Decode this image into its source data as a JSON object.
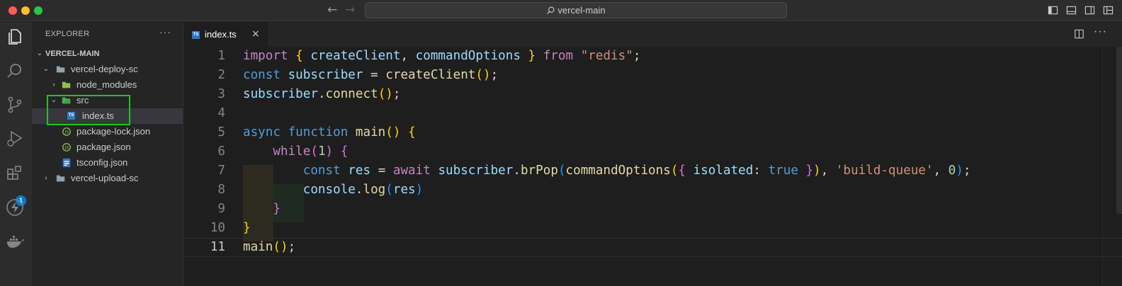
{
  "window": {
    "search_text": "vercel-main"
  },
  "activity_bar": {
    "items": [
      "explorer-icon",
      "search-icon",
      "source-control-icon",
      "run-debug-icon",
      "extensions-icon",
      "lightning-icon",
      "docker-icon"
    ],
    "extensions_badge": "1"
  },
  "explorer": {
    "header": "EXPLORER",
    "more": "···",
    "root": "VERCEL-MAIN",
    "tree": [
      {
        "label": "vercel-deploy-sc",
        "type": "folder",
        "expanded": true
      },
      {
        "label": "node_modules",
        "type": "folder",
        "expanded": false
      },
      {
        "label": "src",
        "type": "folder",
        "expanded": true
      },
      {
        "label": "index.ts",
        "type": "ts-file",
        "selected": true
      },
      {
        "label": "package-lock.json",
        "type": "json-file"
      },
      {
        "label": "package.json",
        "type": "json-file"
      },
      {
        "label": "tsconfig.json",
        "type": "tsconfig-file"
      },
      {
        "label": "vercel-upload-sc",
        "type": "folder",
        "expanded": false
      }
    ]
  },
  "editor": {
    "tab": {
      "label": "index.ts",
      "icon_text": "TS",
      "close": "×"
    },
    "more": "···",
    "line_numbers": [
      "1",
      "2",
      "3",
      "4",
      "5",
      "6",
      "7",
      "8",
      "9",
      "10",
      "11"
    ],
    "current_line": 11,
    "code_lines": [
      "import { createClient, commandOptions } from \"redis\";",
      "const subscriber = createClient();",
      "subscriber.connect();",
      "",
      "async function main() {",
      "    while(1) {",
      "        const res = await subscriber.brPop(commandOptions({ isolated: true }), 'build-queue', 0);",
      "        console.log(res)",
      "    }",
      "}",
      "main();"
    ]
  },
  "colors": {
    "keyword_control": "#c586c0",
    "keyword": "#569cd6",
    "variable": "#9cdcfe",
    "function": "#dcdcaa",
    "string": "#ce9178",
    "number": "#b5cea8",
    "bracket_1": "#ffd700",
    "bracket_2": "#da70d6",
    "bracket_3": "#179fff",
    "highlight_box": "#22c322",
    "ts_blue": "#3178c6"
  }
}
